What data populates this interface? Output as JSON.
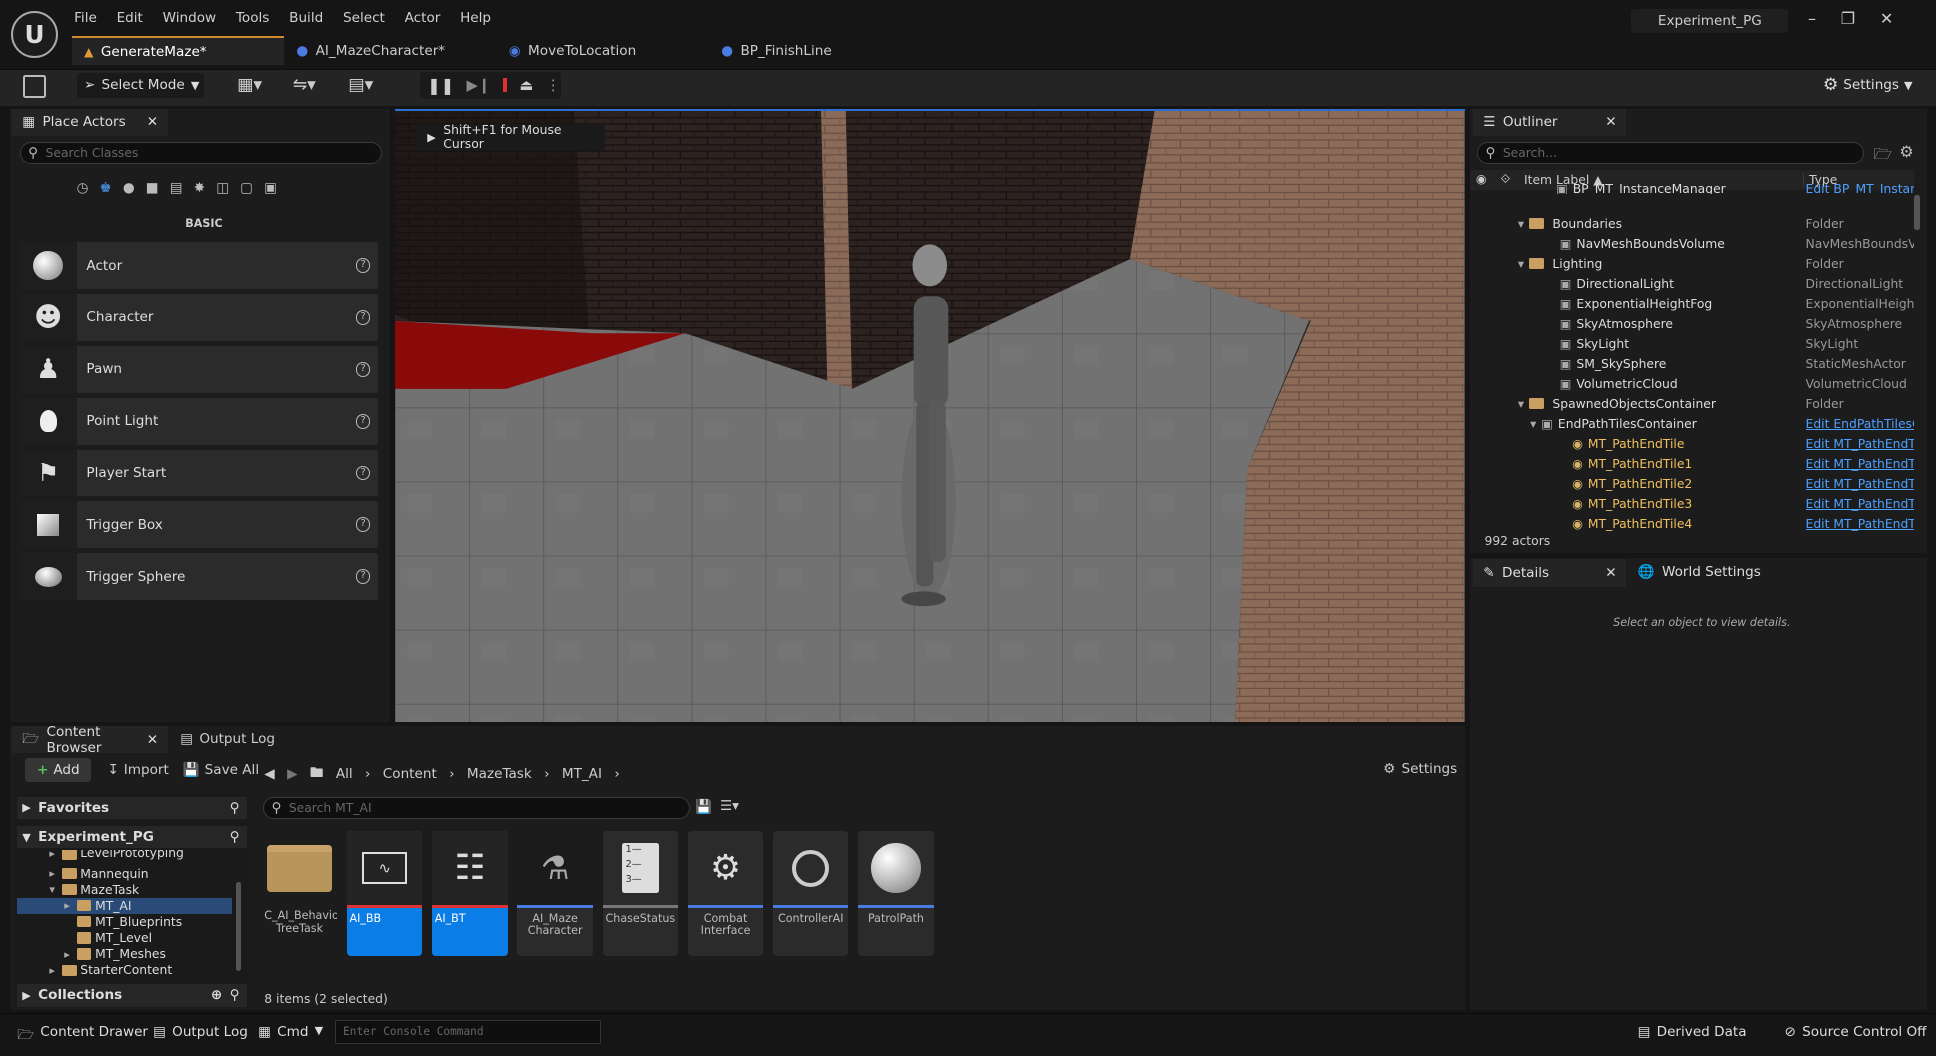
{
  "menu": [
    "File",
    "Edit",
    "Window",
    "Tools",
    "Build",
    "Select",
    "Actor",
    "Help"
  ],
  "project": "Experiment_PG",
  "tabs": [
    "GenerateMaze*",
    "AI_MazeCharacter*",
    "MoveToLocation",
    "BP_FinishLine"
  ],
  "toolbar": {
    "select_mode": "Select Mode",
    "settings": "Settings"
  },
  "place_actors": {
    "title": "Place Actors",
    "search_placeholder": "Search Classes",
    "category": "BASIC",
    "items": [
      "Actor",
      "Character",
      "Pawn",
      "Point Light",
      "Player Start",
      "Trigger Box",
      "Trigger Sphere"
    ]
  },
  "viewport": {
    "hint": "Shift+F1 for Mouse Cursor"
  },
  "outliner": {
    "title": "Outliner",
    "search_placeholder": "Search...",
    "col_label": "Item Label",
    "col_type": "Type",
    "actors": "992 actors",
    "rows": [
      {
        "label": "BP_MT_InstanceManager",
        "type": "Edit BP_MT_Instan"
      },
      {
        "label": "Boundaries",
        "type": "Folder"
      },
      {
        "label": "NavMeshBoundsVolume",
        "type": "NavMeshBoundsV"
      },
      {
        "label": "Lighting",
        "type": "Folder"
      },
      {
        "label": "DirectionalLight",
        "type": "DirectionalLight"
      },
      {
        "label": "ExponentialHeightFog",
        "type": "ExponentialHeight"
      },
      {
        "label": "SkyAtmosphere",
        "type": "SkyAtmosphere"
      },
      {
        "label": "SkyLight",
        "type": "SkyLight"
      },
      {
        "label": "SM_SkySphere",
        "type": "StaticMeshActor"
      },
      {
        "label": "VolumetricCloud",
        "type": "VolumetricCloud"
      },
      {
        "label": "SpawnedObjectsContainer",
        "type": "Folder"
      },
      {
        "label": "EndPathTilesContainer",
        "type": "Edit EndPathTilesC"
      },
      {
        "label": "MT_PathEndTile",
        "type": "Edit MT_PathEndT"
      },
      {
        "label": "MT_PathEndTile1",
        "type": "Edit MT_PathEndT"
      },
      {
        "label": "MT_PathEndTile2",
        "type": "Edit MT_PathEndT"
      },
      {
        "label": "MT_PathEndTile3",
        "type": "Edit MT_PathEndT"
      },
      {
        "label": "MT_PathEndTile4",
        "type": "Edit MT_PathEndT"
      }
    ]
  },
  "details": {
    "tab": "Details",
    "world_tab": "World Settings",
    "empty": "Select an object to view details."
  },
  "content_browser": {
    "tab": "Content Browser",
    "output_tab": "Output Log",
    "add": "Add",
    "import": "Import",
    "save_all": "Save All",
    "breadcrumb": [
      "All",
      "Content",
      "MazeTask",
      "MT_AI"
    ],
    "settings": "Settings",
    "favorites": "Favorites",
    "project": "Experiment_PG",
    "collections": "Collections",
    "tree": [
      "LevelPrototyping",
      "Mannequin",
      "MazeTask",
      "MT_AI",
      "MT_Blueprints",
      "MT_Level",
      "MT_Meshes",
      "StarterContent"
    ],
    "search_placeholder": "Search MT_AI",
    "assets": [
      "C_AI_Behavior TreeTask",
      "AI_BB",
      "AI_BT",
      "AI_Maze Character",
      "ChaseStatus",
      "Combat Interface",
      "ControllerAI",
      "PatrolPath"
    ],
    "status": "8 items (2 selected)"
  },
  "statusbar": {
    "content_drawer": "Content Drawer",
    "output_log": "Output Log",
    "cmd": "Cmd",
    "console_placeholder": "Enter Console Command",
    "derived": "Derived Data",
    "source": "Source Control Off"
  }
}
